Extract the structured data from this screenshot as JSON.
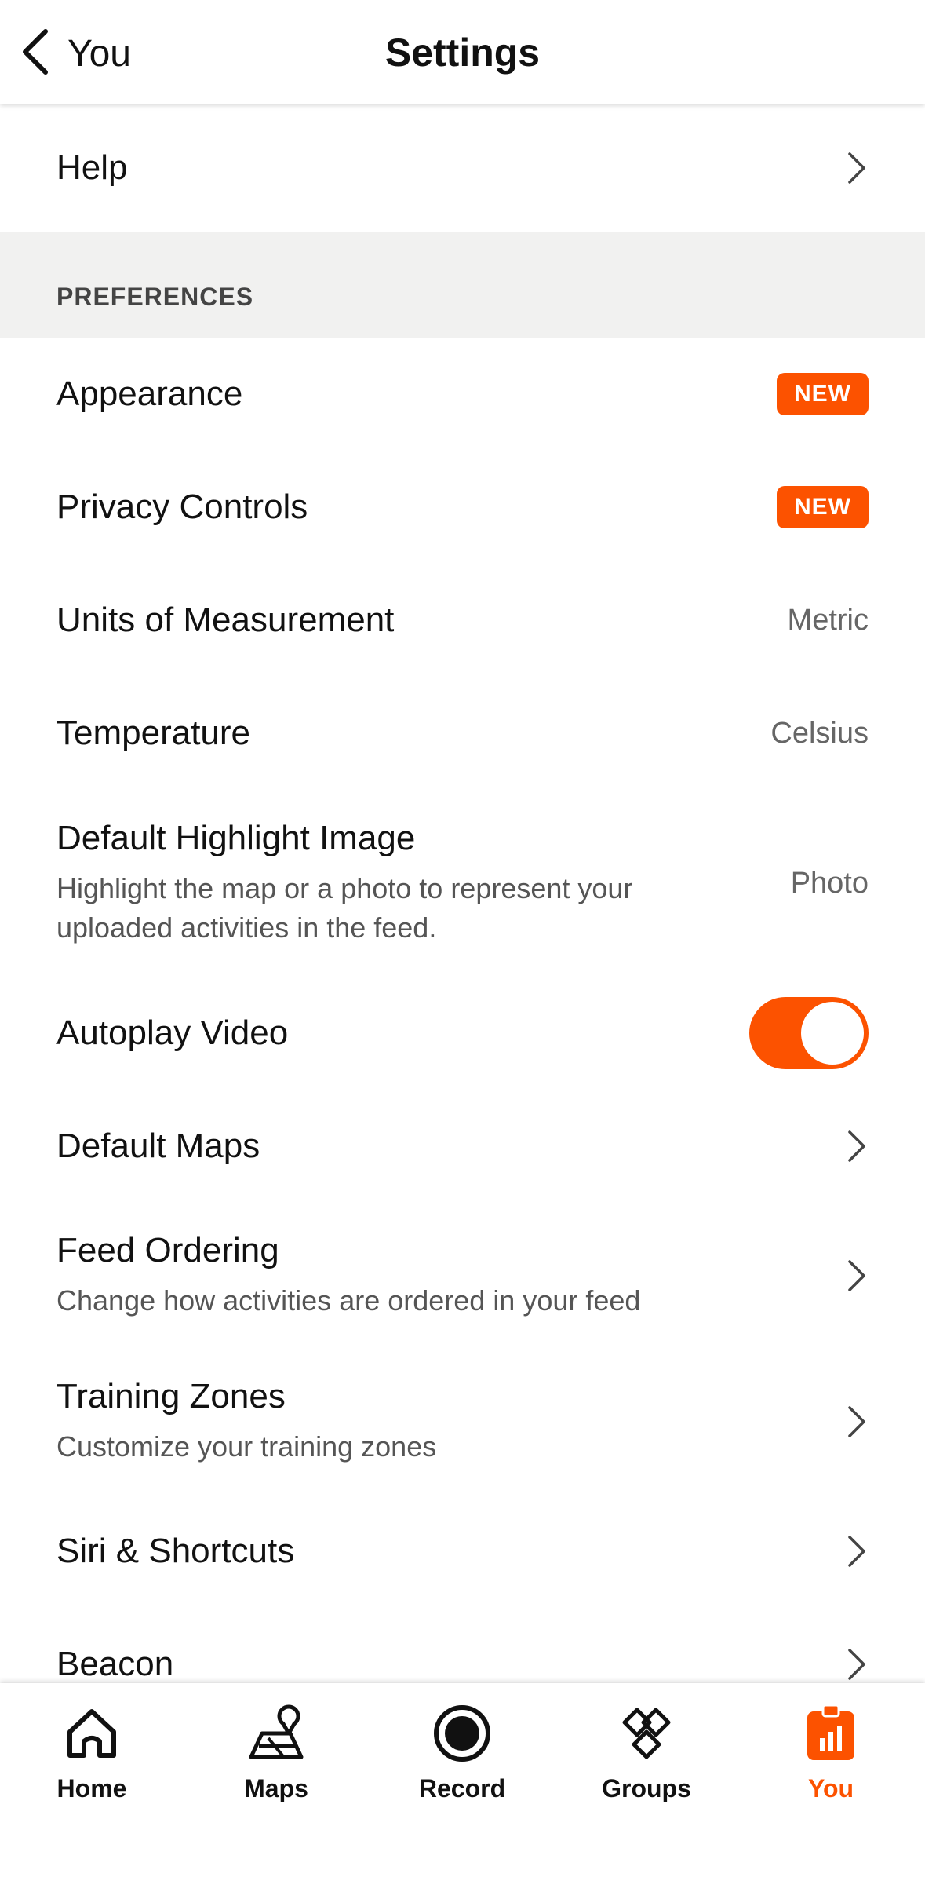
{
  "header": {
    "back_label": "You",
    "title": "Settings"
  },
  "help": {
    "label": "Help"
  },
  "section": {
    "title": "PREFERENCES"
  },
  "prefs": {
    "appearance": {
      "label": "Appearance",
      "badge": "NEW"
    },
    "privacy": {
      "label": "Privacy Controls",
      "badge": "NEW"
    },
    "units": {
      "label": "Units of Measurement",
      "value": "Metric"
    },
    "temperature": {
      "label": "Temperature",
      "value": "Celsius"
    },
    "highlight": {
      "label": "Default Highlight Image",
      "sub": "Highlight the map or a photo to represent your uploaded activities in the feed.",
      "value": "Photo"
    },
    "autoplay": {
      "label": "Autoplay Video",
      "enabled": true
    },
    "maps": {
      "label": "Default Maps"
    },
    "feed": {
      "label": "Feed Ordering",
      "sub": "Change how activities are ordered in your feed"
    },
    "zones": {
      "label": "Training Zones",
      "sub": "Customize your training zones"
    },
    "siri": {
      "label": "Siri & Shortcuts"
    },
    "beacon": {
      "label": "Beacon"
    }
  },
  "tabs": [
    {
      "label": "Home",
      "icon": "home-icon"
    },
    {
      "label": "Maps",
      "icon": "maps-icon"
    },
    {
      "label": "Record",
      "icon": "record-icon"
    },
    {
      "label": "Groups",
      "icon": "groups-icon"
    },
    {
      "label": "You",
      "icon": "you-icon",
      "active": true
    }
  ],
  "colors": {
    "accent": "#fc5200",
    "section_bg": "#f1f1f0"
  }
}
